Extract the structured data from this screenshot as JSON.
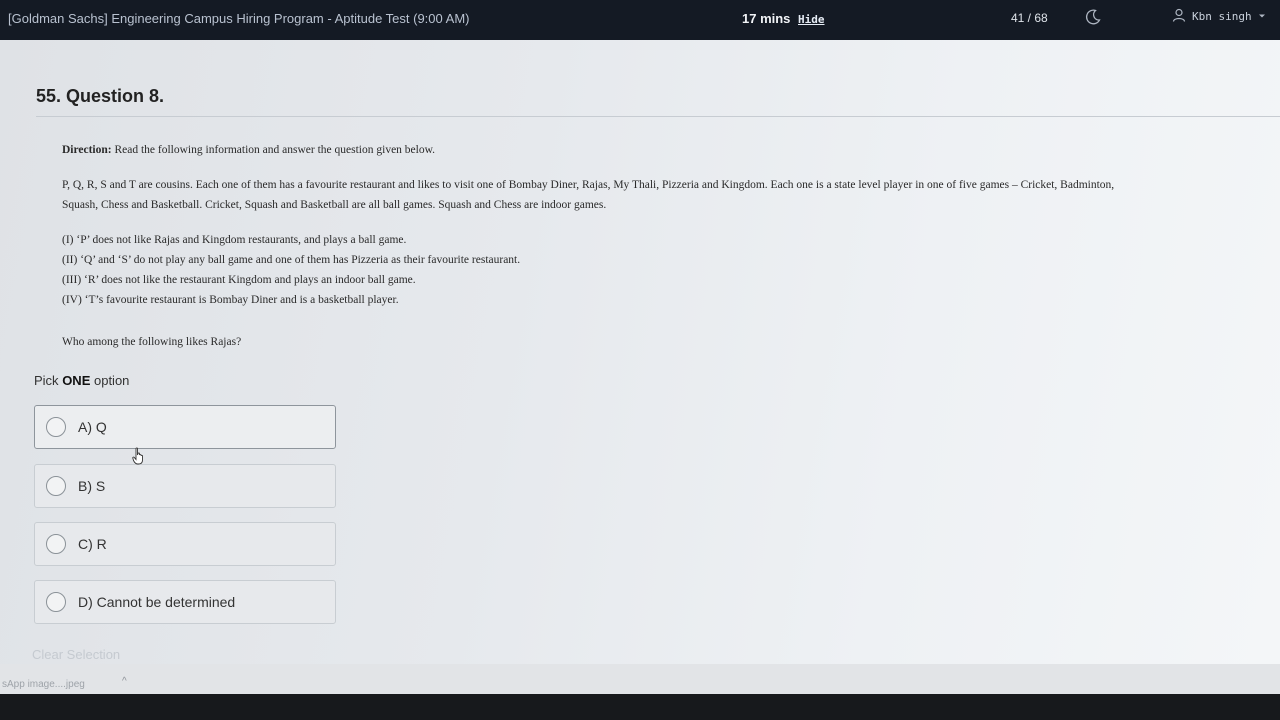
{
  "header": {
    "test_title": "[Goldman Sachs] Engineering Campus Hiring Program - Aptitude Test (9:00 AM)",
    "timer": "17 mins",
    "hide_label": "Hide",
    "progress": "41 / 68",
    "theme_icon": "moon-icon",
    "user_icon": "user-icon",
    "user_name": "Kbn singh",
    "user_menu_icon": "caret-down-icon"
  },
  "question": {
    "title": "55. Question 8.",
    "direction_label": "Direction:",
    "direction_text": "Read the following information and answer the question given below.",
    "paragraph_1": "P, Q, R, S and T are cousins. Each one of them has a favourite restaurant and likes to visit one of Bombay Diner, Rajas, My Thali, Pizzeria and Kingdom. Each one is a state level player in one of five games – Cricket, Badminton,",
    "paragraph_2": "Squash, Chess and Basketball. Cricket, Squash and Basketball are all ball games. Squash and Chess are indoor games.",
    "clues": [
      "(I) ‘P’ does not like Rajas and Kingdom restaurants, and plays a ball game.",
      "(II) ‘Q’ and ‘S’ do not play any ball game and one of them has Pizzeria as their favourite restaurant.",
      "(III) ‘R’ does not like the restaurant Kingdom and plays an indoor ball game.",
      "(IV) ‘T’s favourite restaurant is Bombay Diner and is a basketball player."
    ],
    "prompt": "Who among the following likes Rajas?"
  },
  "answer": {
    "pick_prefix": "Pick",
    "pick_emphasis": "ONE",
    "pick_suffix": "option",
    "options": [
      {
        "label": "A) Q"
      },
      {
        "label": "B) S"
      },
      {
        "label": "C) R"
      },
      {
        "label": "D) Cannot be determined"
      }
    ],
    "clear_label": "Clear Selection"
  },
  "download_bar": {
    "file_name": "sApp image....jpeg",
    "caret": "^"
  }
}
